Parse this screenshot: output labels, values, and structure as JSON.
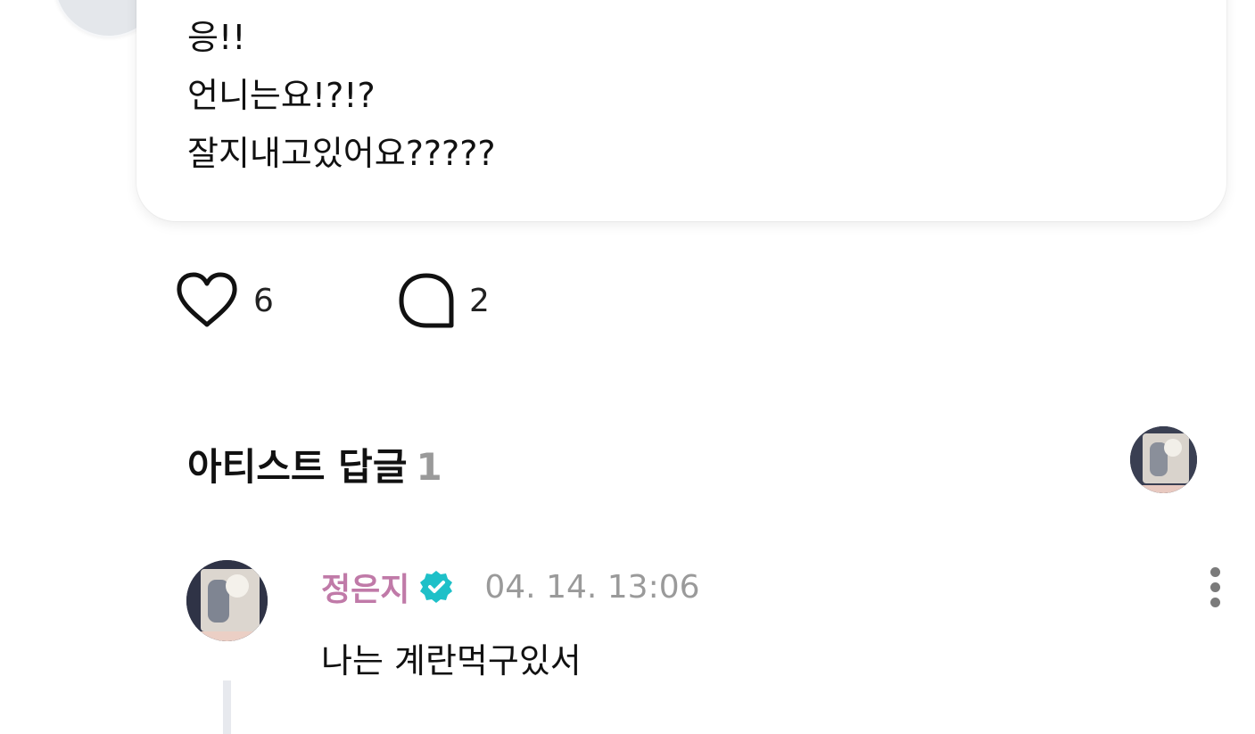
{
  "post": {
    "lines": [
      "응!!",
      "언니는요!?!?",
      "잘지내고있어요?????"
    ],
    "actions": {
      "like": {
        "icon": "heart-outline-icon",
        "count": "6"
      },
      "comment": {
        "icon": "speech-bubble-icon",
        "count": "2"
      }
    }
  },
  "artist_replies": {
    "title": "아티스트 답글",
    "count": "1"
  },
  "comment": {
    "author": "정은지",
    "verified_icon": "verified-badge-icon",
    "verified_color": "#1ec0c8",
    "author_color": "#c07aa8",
    "timestamp": "04. 14. 13:06",
    "text": "나는 계란먹구있서",
    "more_icon": "more-vertical-icon"
  }
}
